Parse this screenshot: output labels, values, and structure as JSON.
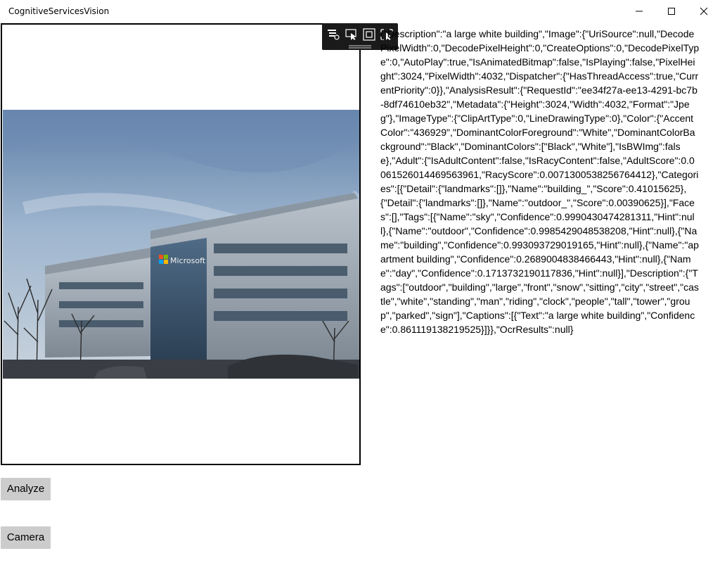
{
  "window": {
    "title": "CognitiveServicesVision",
    "controls": {
      "minimize_icon": "minimize-icon",
      "maximize_icon": "maximize-icon",
      "close_icon": "close-icon"
    }
  },
  "image_panel": {
    "photo_subject": "building-photo",
    "signage": "Microsoft"
  },
  "debug_toolbar": {
    "icons": [
      "live-visual-tree-icon",
      "select-element-icon",
      "display-layout-adorners-icon",
      "track-focus-icon"
    ]
  },
  "analysis_output": "{\"Description\":\"a large white building\",\"Image\":{\"UriSource\":null,\"DecodePixelWidth\":0,\"DecodePixelHeight\":0,\"CreateOptions\":0,\"DecodePixelType\":0,\"AutoPlay\":true,\"IsAnimatedBitmap\":false,\"IsPlaying\":false,\"PixelHeight\":3024,\"PixelWidth\":4032,\"Dispatcher\":{\"HasThreadAccess\":true,\"CurrentPriority\":0}},\"AnalysisResult\":{\"RequestId\":\"ee34f27a-ee13-4291-bc7b-8df74610eb32\",\"Metadata\":{\"Height\":3024,\"Width\":4032,\"Format\":\"Jpeg\"},\"ImageType\":{\"ClipArtType\":0,\"LineDrawingType\":0},\"Color\":{\"AccentColor\":\"436929\",\"DominantColorForeground\":\"White\",\"DominantColorBackground\":\"Black\",\"DominantColors\":[\"Black\",\"White\"],\"IsBWImg\":false},\"Adult\":{\"IsAdultContent\":false,\"IsRacyContent\":false,\"AdultScore\":0.0061526014469563961,\"RacyScore\":0.0071300538256764412},\"Categories\":[{\"Detail\":{\"landmarks\":[]},\"Name\":\"building_\",\"Score\":0.41015625},{\"Detail\":{\"landmarks\":[]},\"Name\":\"outdoor_\",\"Score\":0.00390625}],\"Faces\":[],\"Tags\":[{\"Name\":\"sky\",\"Confidence\":0.9990430474281311,\"Hint\":null},{\"Name\":\"outdoor\",\"Confidence\":0.9985429048538208,\"Hint\":null},{\"Name\":\"building\",\"Confidence\":0.993093729019165,\"Hint\":null},{\"Name\":\"apartment building\",\"Confidence\":0.2689004838466443,\"Hint\":null},{\"Name\":\"day\",\"Confidence\":0.171373219011783​6,\"Hint\":null}],\"Description\":{\"Tags\":[\"outdoor\",\"building\",\"large\",\"front\",\"snow\",\"sitting\",\"city\",\"street\",\"castle\",\"white\",\"standing\",\"man\",\"riding\",\"clock\",\"people\",\"tall\",\"tower\",\"group\",\"parked\",\"sign\"],\"Captions\":[{\"Text\":\"a large white building\",\"Confidence\":0.861119138219525}]}},\"OcrResults\":null}",
  "buttons": {
    "analyze": "Analyze",
    "camera": "Camera"
  },
  "colors": {
    "button_bg": "#cccccc",
    "toolbar_bg": "#1a1a1a",
    "frame_border": "#000000"
  }
}
